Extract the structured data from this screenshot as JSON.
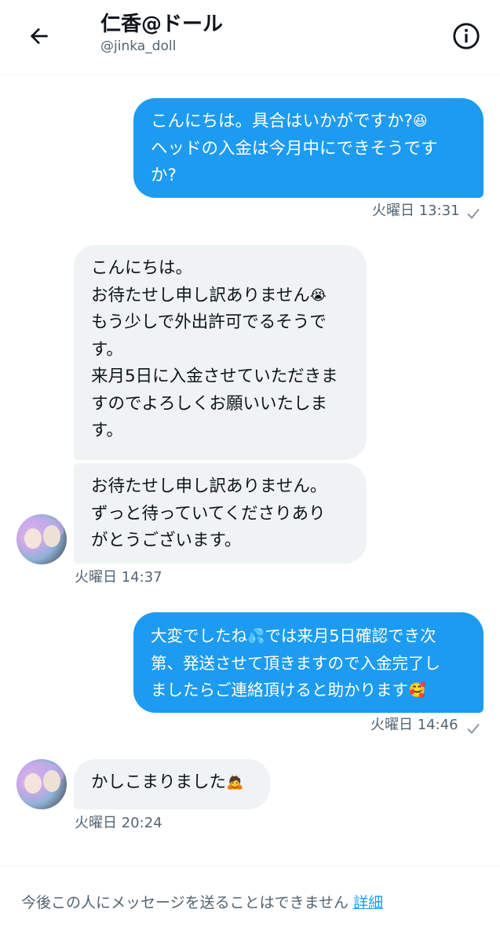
{
  "header": {
    "back_icon": "back-arrow-icon",
    "name": "仁香@ドール",
    "handle": "@jinka_doll",
    "info_icon": "info-icon"
  },
  "messages": {
    "m1": {
      "direction": "sent",
      "lines": [
        "こんにちは。具合はいかがですか?",
        "ヘッドの入金は今月中にできそうです",
        "か?"
      ],
      "emoji": "😆",
      "time": "火曜日 13:31",
      "status_icon": "read-check-icon"
    },
    "m2": {
      "direction": "received",
      "lines": [
        "こんにちは。",
        "お待たせし申し訳ありません",
        "もう少しで外出許可でるそうで",
        "す。",
        "来月5日に入金させていただきま",
        "すのでよろしくお願いいたしま",
        "す。"
      ],
      "emoji": "😭"
    },
    "m3": {
      "direction": "received",
      "lines": [
        "お待たせし申し訳ありません。",
        "ずっと待っていてくださりあり",
        "がとうございます。"
      ],
      "time": "火曜日 14:37",
      "avatar": "doll-avatar"
    },
    "m4": {
      "direction": "sent",
      "lines": [
        "大変でしたね",
        "では来月5日確認でき次",
        "第、発送させて頂きますので入金完了し",
        "ましたらご連絡頂けると助かります"
      ],
      "emoji_a": "💦",
      "emoji_b": "🥰",
      "time": "火曜日 14:46",
      "status_icon": "read-check-icon"
    },
    "m5": {
      "direction": "received",
      "text": "かしこまりました",
      "emoji": "🙇",
      "time": "火曜日 20:24",
      "avatar": "doll-avatar"
    }
  },
  "footer": {
    "notice": "今後この人にメッセージを送ることはできません",
    "link": "詳細"
  },
  "colors": {
    "sent_bubble": "#1d9bf0",
    "received_bubble": "#eff3f4",
    "secondary_text": "#536471",
    "link": "#1d9bf0"
  }
}
